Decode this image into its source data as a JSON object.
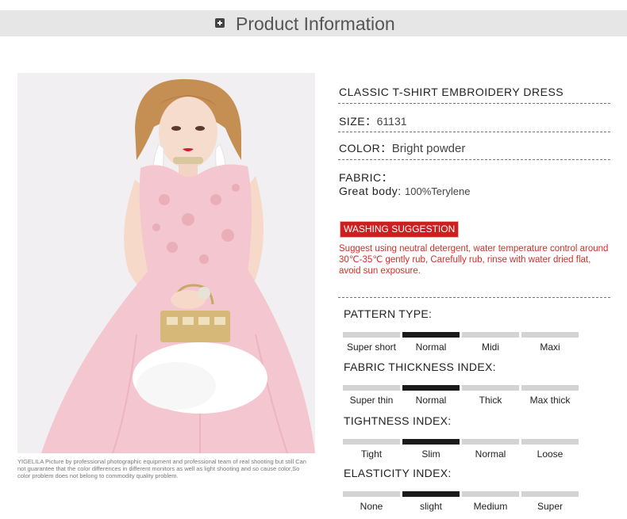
{
  "header": {
    "title": "Product Information",
    "icon": "plus-square-icon"
  },
  "photo": {
    "subject": "model-in-pink-dress-photo",
    "caption": "YIGELILA Picture by professional photographic equipment and professional team of real shooting but still Can not guarantee that the color differences in different monitors as well as light shooting and so cause color,So color problem does not belong to commodity quality problem."
  },
  "product": {
    "name": "CLASSIC T-SHIRT EMBROIDERY DRESS",
    "size_label": "SIZE：",
    "size_value": "61131",
    "color_label": "COLOR：",
    "color_value": "Bright powder",
    "fabric_label": "FABRIC：",
    "fabric_body_label": "Great body: ",
    "fabric_body_value": "100%Terylene"
  },
  "washing": {
    "badge": "WASHING SUGGESTION",
    "text": "Suggest using neutral detergent, water temperature control around 30℃-35℃ gently rub, Carefully rub, rinse with water dried flat, avoid sun exposure."
  },
  "indices": [
    {
      "title": "PATTERN TYPE:",
      "options": [
        "Super short",
        "Normal",
        "Midi",
        "Maxi"
      ],
      "selected": 1
    },
    {
      "title": "FABRIC THICKNESS INDEX:",
      "options": [
        "Super thin",
        "Normal",
        "Thick",
        "Max thick"
      ],
      "selected": 1
    },
    {
      "title": "TIGHTNESS INDEX:",
      "options": [
        "Tight",
        "Slim",
        "Normal",
        "Loose"
      ],
      "selected": 1
    },
    {
      "title": "ELASTICITY INDEX:",
      "options": [
        "None",
        "slight",
        "Medium",
        "Super"
      ],
      "selected": 1
    }
  ],
  "colors": {
    "header_bg": "#e6e6e6",
    "accent_red": "#cc1f1f",
    "selected_bar": "#1a1a1a",
    "unselected_bar": "#d3d3d3",
    "dress_pink": "#f4c6cf"
  }
}
